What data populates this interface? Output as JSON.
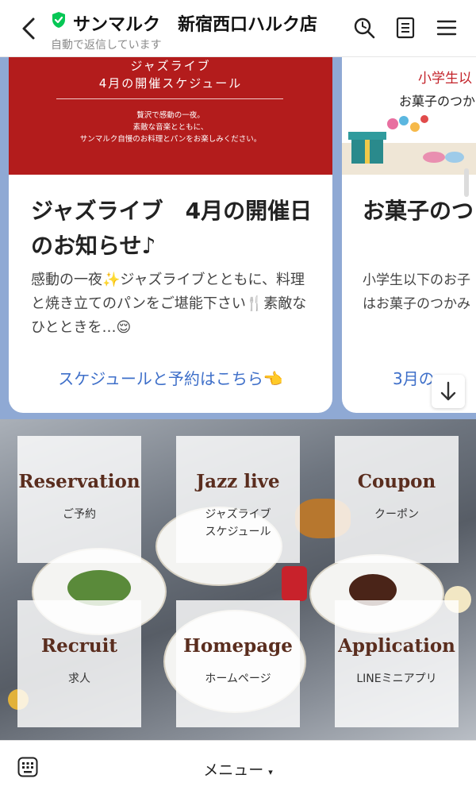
{
  "header": {
    "title": "サンマルク　新宿西口ハルク店",
    "subtitle": "自動で返信しています",
    "icons": [
      "back-icon",
      "verified-shield-icon",
      "search-clock-icon",
      "note-icon",
      "menu-icon"
    ]
  },
  "carousel": {
    "cards": [
      {
        "banner_title_1": "ジャズライブ",
        "banner_title_2": "4月の開催スケジュール",
        "banner_body_1": "贅沢で感動の一夜。",
        "banner_body_2": "素敵な音楽とともに、",
        "banner_body_3": "サンマルク自慢のお料理とパンをお楽しみください。",
        "title": "ジャズライブ　4月の開催日のお知らせ♪",
        "description": "感動の一夜✨ジャズライブとともに、料理と焼き立てのパンをご堪能下さい🍴素敵なひとときを…😌",
        "link": "スケジュールと予約はこちら👈"
      },
      {
        "banner_red": "小学生以",
        "banner_sub": "お菓子のつか",
        "title": "お菓子のつ",
        "description_1": "小学生以下のお子",
        "description_2": "はお菓子のつかみ",
        "link": "3月の"
      }
    ]
  },
  "rich_menu": {
    "tiles": [
      {
        "en": "Reservation",
        "ja": "ご予約"
      },
      {
        "en": "Jazz live",
        "ja": "ジャズライブ\nスケジュール"
      },
      {
        "en": "Coupon",
        "ja": "クーポン"
      },
      {
        "en": "Recruit",
        "ja": "求人"
      },
      {
        "en": "Homepage",
        "ja": "ホームページ"
      },
      {
        "en": "Application",
        "ja": "LINEミニアプリ"
      }
    ]
  },
  "bottom_bar": {
    "menu_label": "メニュー",
    "menu_arrow": "▾"
  },
  "colors": {
    "banner_red": "#b31c1c",
    "carousel_bg": "#8fa9d4",
    "link_blue": "#3e6fc9",
    "tile_text_brown": "#5a2d1e",
    "verified_green": "#06c755"
  }
}
